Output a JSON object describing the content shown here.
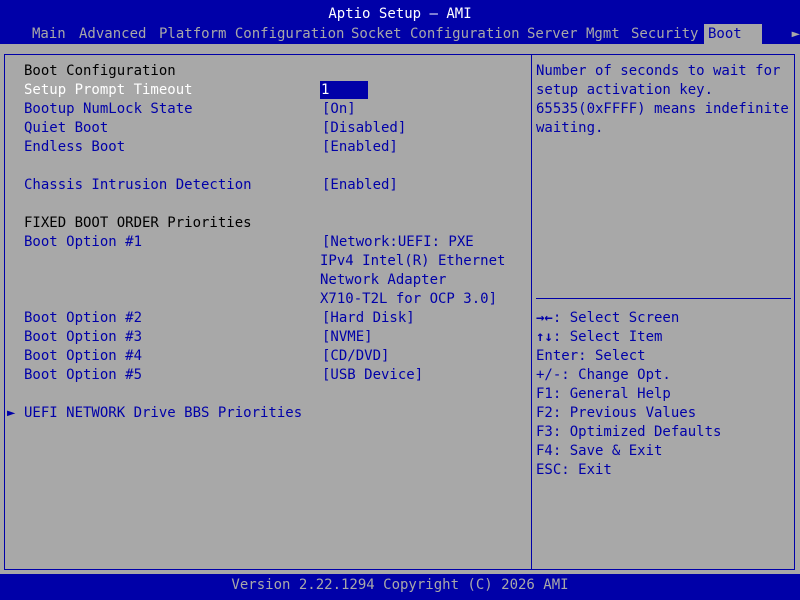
{
  "window": {
    "title": "Aptio Setup – AMI"
  },
  "menu": {
    "tabs": [
      {
        "label": "Main"
      },
      {
        "label": "Advanced"
      },
      {
        "label": "Platform Configuration"
      },
      {
        "label": "Socket Configuration"
      },
      {
        "label": "Server Mgmt"
      },
      {
        "label": "Security"
      },
      {
        "label": "Boot",
        "active": true
      }
    ],
    "more_arrow": "►"
  },
  "settings": {
    "section_title": "Boot Configuration",
    "setup_prompt_timeout": {
      "label": "Setup Prompt Timeout",
      "value": "1"
    },
    "bootup_numlock": {
      "label": "Bootup NumLock State",
      "value": "[On]"
    },
    "quiet_boot": {
      "label": "Quiet Boot",
      "value": "[Disabled]"
    },
    "endless_boot": {
      "label": "Endless Boot",
      "value": "[Enabled]"
    },
    "chassis_intrusion": {
      "label": "Chassis Intrusion Detection",
      "value": "[Enabled]"
    },
    "fixed_order_title": "FIXED BOOT ORDER Priorities",
    "boot_options": [
      {
        "label": "Boot Option #1",
        "value_lines": [
          "[Network:UEFI: PXE",
          "IPv4 Intel(R) Ethernet",
          "Network Adapter",
          "X710-T2L for OCP 3.0]"
        ]
      },
      {
        "label": "Boot Option #2",
        "value": "[Hard Disk]"
      },
      {
        "label": "Boot Option #3",
        "value": "[NVME]"
      },
      {
        "label": "Boot Option #4",
        "value": "[CD/DVD]"
      },
      {
        "label": "Boot Option #5",
        "value": "[USB Device]"
      }
    ],
    "submenu_arrow": "►",
    "uefi_network": {
      "label": "UEFI NETWORK Drive BBS Priorities"
    }
  },
  "help": {
    "description": [
      "Number of seconds to wait for",
      "setup activation key.",
      "65535(0xFFFF) means indefinite",
      "waiting."
    ],
    "keys": [
      {
        "key": "→←",
        "text": ": Select Screen"
      },
      {
        "key": "↑↓",
        "text": ": Select Item"
      },
      {
        "key": "",
        "text": "Enter: Select"
      },
      {
        "key": "",
        "text": "+/-: Change Opt."
      },
      {
        "key": "",
        "text": "F1: General Help"
      },
      {
        "key": "",
        "text": "F2: Previous Values"
      },
      {
        "key": "",
        "text": "F3: Optimized Defaults"
      },
      {
        "key": "",
        "text": "F4: Save & Exit"
      },
      {
        "key": "",
        "text": "ESC: Exit"
      }
    ]
  },
  "footer": {
    "text": "Version 2.22.1294 Copyright (C) 2026 AMI"
  },
  "colors": {
    "background_blue": "#0000a8",
    "panel_gray": "#a8a8a8",
    "highlight_text": "#ffffff",
    "static_text": "#000000"
  }
}
